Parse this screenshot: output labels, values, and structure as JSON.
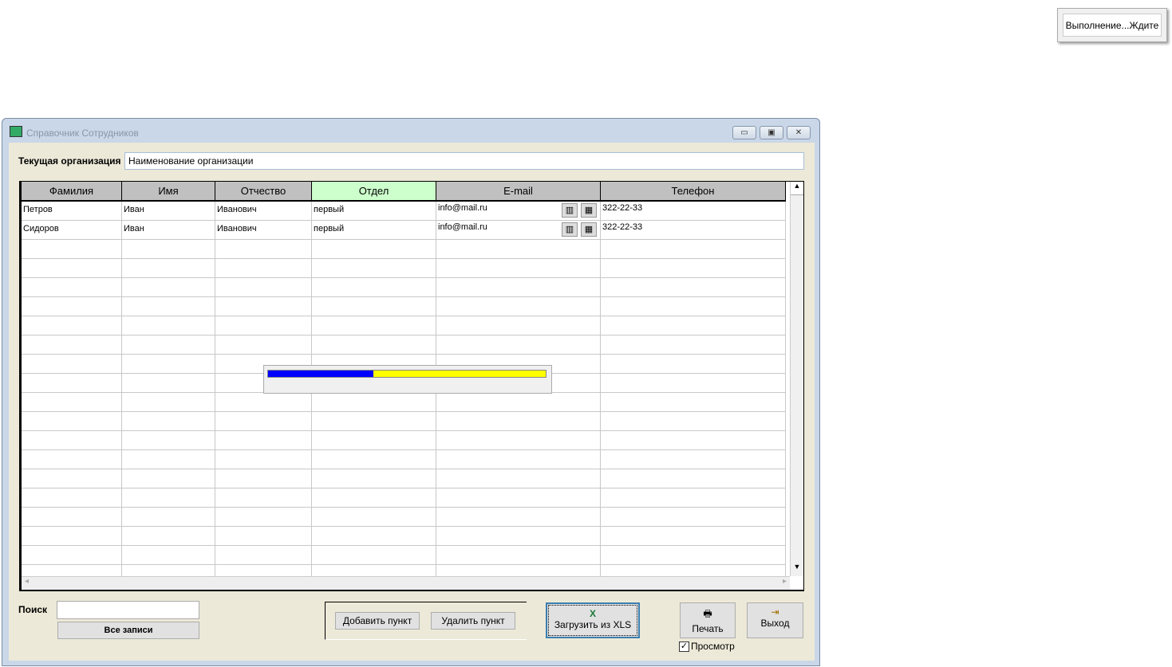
{
  "busy_popup": "Выполнение...Ждите",
  "window": {
    "title": "Справочник Сотрудников",
    "min": "▭",
    "max": "▣",
    "close": "✕"
  },
  "org": {
    "label": "Текущая организация",
    "value": "Наименование организации"
  },
  "table": {
    "columns": [
      "Фамилия",
      "Имя",
      "Отчество",
      "Отдел",
      "E-mail",
      "Телефон"
    ],
    "rows": [
      [
        "Петров",
        "Иван",
        "Иванович",
        "первый",
        "info@mail.ru",
        "322-22-33"
      ],
      [
        "Сидоров",
        "Иван",
        "Иванович",
        "первый",
        "info@mail.ru",
        "322-22-33"
      ]
    ]
  },
  "progress": {
    "fraction": 0.38,
    "fill_color": "#0000ff",
    "track_color": "#ffff00"
  },
  "search": {
    "label": "Поиск",
    "value": "",
    "all_records": "Все записи"
  },
  "buttons": {
    "add": "Добавить пункт",
    "delete": "Удалить пункт",
    "load_xls": "Загрузить из XLS",
    "print": "Печать",
    "exit": "Выход"
  },
  "preview": {
    "label": "Просмотр",
    "checked": true
  }
}
